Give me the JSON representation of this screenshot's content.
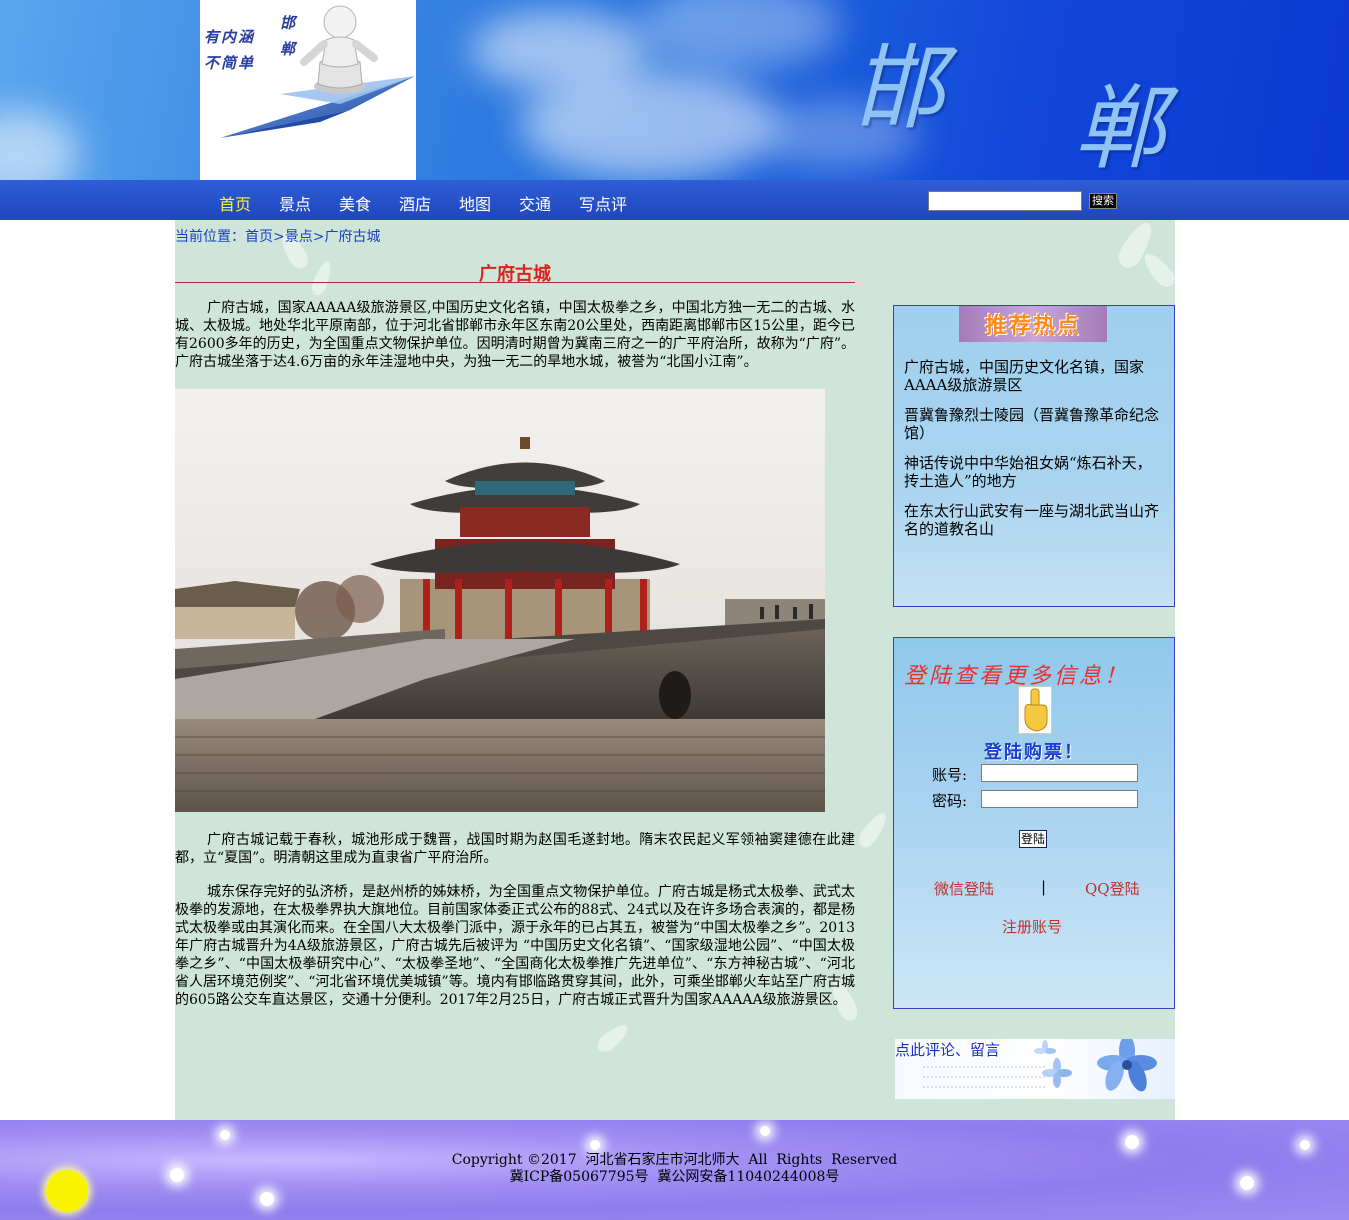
{
  "banner": {
    "logo_text_left": "有内涵 不简单",
    "logo_text_right": "邯 郸",
    "title_char_1": "邯",
    "title_char_2": "郸"
  },
  "nav": {
    "items": [
      "首页",
      "景点",
      "美食",
      "酒店",
      "地图",
      "交通",
      "写点评"
    ],
    "active": "首页",
    "search_value": "",
    "search_button": "搜索"
  },
  "breadcrumb": {
    "prefix": "当前位置：",
    "home": "首页",
    "sep1": ">",
    "section": "景点",
    "sep2": ">",
    "current": "广府古城"
  },
  "article": {
    "title": "广府古城",
    "para1": "广府古城，国家AAAAA级旅游景区,中国历史文化名镇，中国太极拳之乡，中国北方独一无二的古城、水城、太极城。地处华北平原南部，位于河北省邯郸市永年区东南20公里处，西南距离邯郸市区15公里，距今已有2600多年的历史，为全国重点文物保护单位。因明清时期曾为冀南三府之一的广平府治所，故称为“广府”。广府古城坐落于达4.6万亩的永年洼湿地中央，为独一无二的旱地水城，被誉为“北国小江南”。",
    "para2": "广府古城记载于春秋，城池形成于魏晋，战国时期为赵国毛遂封地。隋末农民起义军领袖窦建德在此建都，立“夏国”。明清朝这里成为直隶省广平府治所。",
    "para3": "城东保存完好的弘济桥，是赵州桥的姊妹桥，为全国重点文物保护单位。广府古城是杨式太极拳、武式太极拳的发源地，在太极拳界执大旗地位。目前国家体委正式公布的88式、24式以及在许多场合表演的，都是杨式太极拳或由其演化而来。在全国八大太极拳门派中，源于永年的已占其五，被誉为“中国太极拳之乡”。2013年广府古城晋升为4A级旅游景区，广府古城先后被评为 “中国历史文化名镇”、“国家级湿地公园”、“中国太极拳之乡”、“中国太极拳研究中心”、“太极拳圣地”、“全国商化太极拳推广先进单位”、“东方神秘古城”、“河北省人居环境范例奖”、“河北省环境优美城镇”等。境内有邯临路贯穿其间，此外，可乘坐邯郸火车站至广府古城的605路公交车直达景区，交通十分便利。2017年2月25日，广府古城正式晋升为国家AAAAA级旅游景区。"
  },
  "sidebar": {
    "hot_banner": "推荐热点",
    "hot_items": [
      "广府古城，中国历史文化名镇，国家AAAA级旅游景区",
      "晋冀鲁豫烈士陵园（晋冀鲁豫革命纪念馆）",
      "神话传说中中华始祖女娲“炼石补天，抟土造人”的地方",
      "在东太行山武安有一座与湖北武当山齐名的道教名山"
    ],
    "login": {
      "heading": "登陆查看更多信息！",
      "buy_heading": "登陆购票！",
      "account_label": "账号:",
      "account_value": "",
      "password_label": "密码:",
      "password_value": "",
      "button": "登陆",
      "wechat": "微信登陆",
      "separator": "|",
      "qq": "QQ登陆",
      "register": "注册账号"
    },
    "comment_link": "点此评论、留言"
  },
  "footer": {
    "line1": "Copyright ©2017  河北省石家庄市河北师大  All  Rights  Reserved",
    "line2": "冀ICP备05067795号  冀公网安备11040244008号"
  }
}
